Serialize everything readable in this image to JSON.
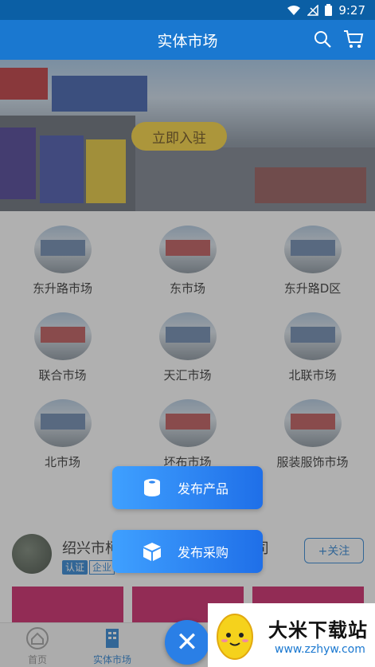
{
  "status_bar": {
    "time": "9:27"
  },
  "app_bar": {
    "title": "实体市场"
  },
  "banner": {
    "cta_label": "立即入驻"
  },
  "markets": [
    {
      "label": "东升路市场"
    },
    {
      "label": "东市场"
    },
    {
      "label": "东升路D区"
    },
    {
      "label": "联合市场"
    },
    {
      "label": "天汇市场"
    },
    {
      "label": "北联市场"
    },
    {
      "label": "北市场"
    },
    {
      "label": "坯布市场"
    },
    {
      "label": "服装服饰市场"
    }
  ],
  "store": {
    "name": "绍兴市柯",
    "name_suffix": "司",
    "badge_verified": "认证",
    "badge_type": "企业",
    "follow_label": "+关注"
  },
  "publish_menu": {
    "publish_product": "发布产品",
    "publish_purchase": "发布采购"
  },
  "tabs": [
    {
      "label": "首页",
      "icon": "home-icon"
    },
    {
      "label": "实体市场",
      "icon": "market-icon"
    }
  ],
  "watermark": {
    "title": "大米下载站",
    "url": "www.zzhyw.com"
  },
  "colors": {
    "primary": "#1a78d0",
    "cta": "#f7cf2a",
    "publish_gradient_start": "#3fa0ff",
    "publish_gradient_end": "#1f6fe8"
  }
}
